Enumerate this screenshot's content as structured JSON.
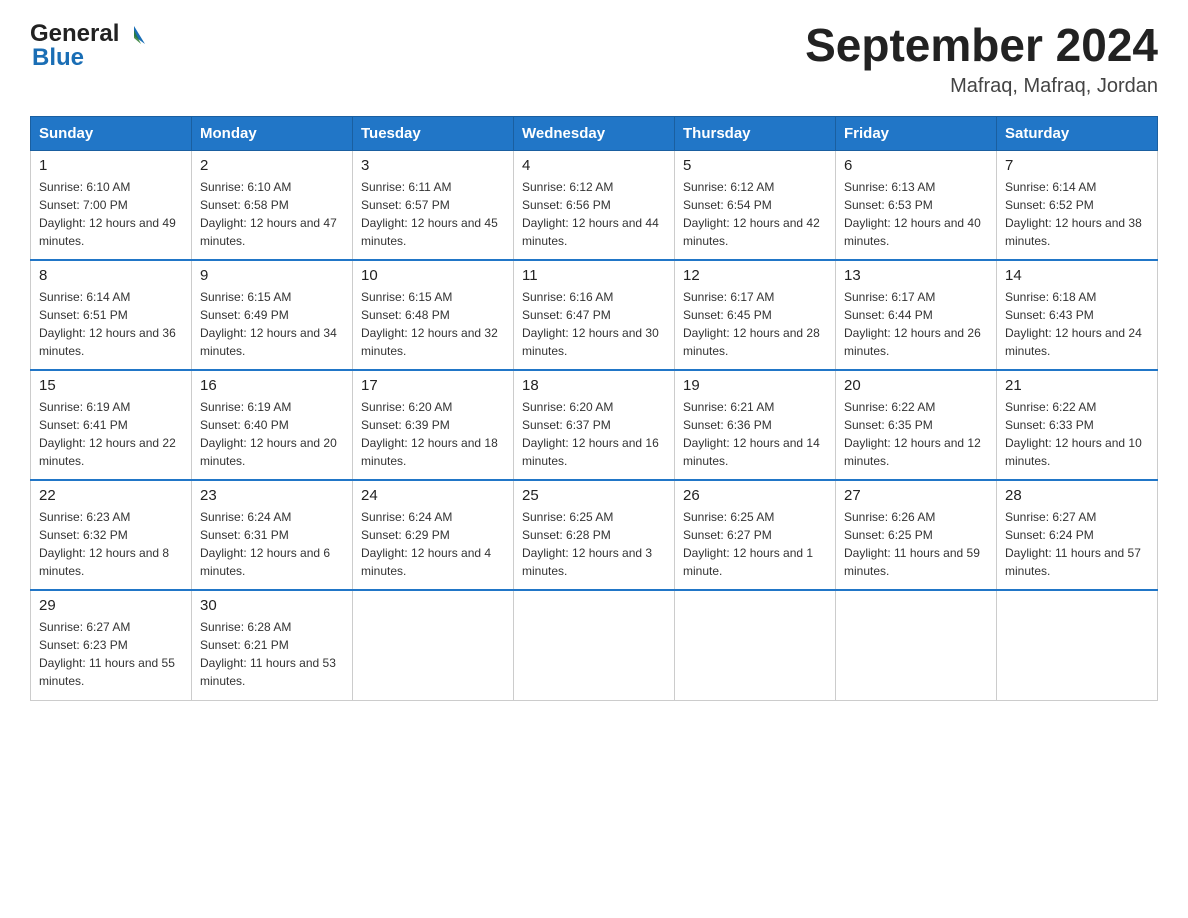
{
  "header": {
    "logo_line1": "General",
    "logo_triangle": "▲",
    "logo_line2": "Blue",
    "title": "September 2024",
    "subtitle": "Mafraq, Mafraq, Jordan"
  },
  "days_of_week": [
    "Sunday",
    "Monday",
    "Tuesday",
    "Wednesday",
    "Thursday",
    "Friday",
    "Saturday"
  ],
  "weeks": [
    [
      {
        "day": "1",
        "sunrise": "6:10 AM",
        "sunset": "7:00 PM",
        "daylight": "12 hours and 49 minutes."
      },
      {
        "day": "2",
        "sunrise": "6:10 AM",
        "sunset": "6:58 PM",
        "daylight": "12 hours and 47 minutes."
      },
      {
        "day": "3",
        "sunrise": "6:11 AM",
        "sunset": "6:57 PM",
        "daylight": "12 hours and 45 minutes."
      },
      {
        "day": "4",
        "sunrise": "6:12 AM",
        "sunset": "6:56 PM",
        "daylight": "12 hours and 44 minutes."
      },
      {
        "day": "5",
        "sunrise": "6:12 AM",
        "sunset": "6:54 PM",
        "daylight": "12 hours and 42 minutes."
      },
      {
        "day": "6",
        "sunrise": "6:13 AM",
        "sunset": "6:53 PM",
        "daylight": "12 hours and 40 minutes."
      },
      {
        "day": "7",
        "sunrise": "6:14 AM",
        "sunset": "6:52 PM",
        "daylight": "12 hours and 38 minutes."
      }
    ],
    [
      {
        "day": "8",
        "sunrise": "6:14 AM",
        "sunset": "6:51 PM",
        "daylight": "12 hours and 36 minutes."
      },
      {
        "day": "9",
        "sunrise": "6:15 AM",
        "sunset": "6:49 PM",
        "daylight": "12 hours and 34 minutes."
      },
      {
        "day": "10",
        "sunrise": "6:15 AM",
        "sunset": "6:48 PM",
        "daylight": "12 hours and 32 minutes."
      },
      {
        "day": "11",
        "sunrise": "6:16 AM",
        "sunset": "6:47 PM",
        "daylight": "12 hours and 30 minutes."
      },
      {
        "day": "12",
        "sunrise": "6:17 AM",
        "sunset": "6:45 PM",
        "daylight": "12 hours and 28 minutes."
      },
      {
        "day": "13",
        "sunrise": "6:17 AM",
        "sunset": "6:44 PM",
        "daylight": "12 hours and 26 minutes."
      },
      {
        "day": "14",
        "sunrise": "6:18 AM",
        "sunset": "6:43 PM",
        "daylight": "12 hours and 24 minutes."
      }
    ],
    [
      {
        "day": "15",
        "sunrise": "6:19 AM",
        "sunset": "6:41 PM",
        "daylight": "12 hours and 22 minutes."
      },
      {
        "day": "16",
        "sunrise": "6:19 AM",
        "sunset": "6:40 PM",
        "daylight": "12 hours and 20 minutes."
      },
      {
        "day": "17",
        "sunrise": "6:20 AM",
        "sunset": "6:39 PM",
        "daylight": "12 hours and 18 minutes."
      },
      {
        "day": "18",
        "sunrise": "6:20 AM",
        "sunset": "6:37 PM",
        "daylight": "12 hours and 16 minutes."
      },
      {
        "day": "19",
        "sunrise": "6:21 AM",
        "sunset": "6:36 PM",
        "daylight": "12 hours and 14 minutes."
      },
      {
        "day": "20",
        "sunrise": "6:22 AM",
        "sunset": "6:35 PM",
        "daylight": "12 hours and 12 minutes."
      },
      {
        "day": "21",
        "sunrise": "6:22 AM",
        "sunset": "6:33 PM",
        "daylight": "12 hours and 10 minutes."
      }
    ],
    [
      {
        "day": "22",
        "sunrise": "6:23 AM",
        "sunset": "6:32 PM",
        "daylight": "12 hours and 8 minutes."
      },
      {
        "day": "23",
        "sunrise": "6:24 AM",
        "sunset": "6:31 PM",
        "daylight": "12 hours and 6 minutes."
      },
      {
        "day": "24",
        "sunrise": "6:24 AM",
        "sunset": "6:29 PM",
        "daylight": "12 hours and 4 minutes."
      },
      {
        "day": "25",
        "sunrise": "6:25 AM",
        "sunset": "6:28 PM",
        "daylight": "12 hours and 3 minutes."
      },
      {
        "day": "26",
        "sunrise": "6:25 AM",
        "sunset": "6:27 PM",
        "daylight": "12 hours and 1 minute."
      },
      {
        "day": "27",
        "sunrise": "6:26 AM",
        "sunset": "6:25 PM",
        "daylight": "11 hours and 59 minutes."
      },
      {
        "day": "28",
        "sunrise": "6:27 AM",
        "sunset": "6:24 PM",
        "daylight": "11 hours and 57 minutes."
      }
    ],
    [
      {
        "day": "29",
        "sunrise": "6:27 AM",
        "sunset": "6:23 PM",
        "daylight": "11 hours and 55 minutes."
      },
      {
        "day": "30",
        "sunrise": "6:28 AM",
        "sunset": "6:21 PM",
        "daylight": "11 hours and 53 minutes."
      },
      null,
      null,
      null,
      null,
      null
    ]
  ]
}
